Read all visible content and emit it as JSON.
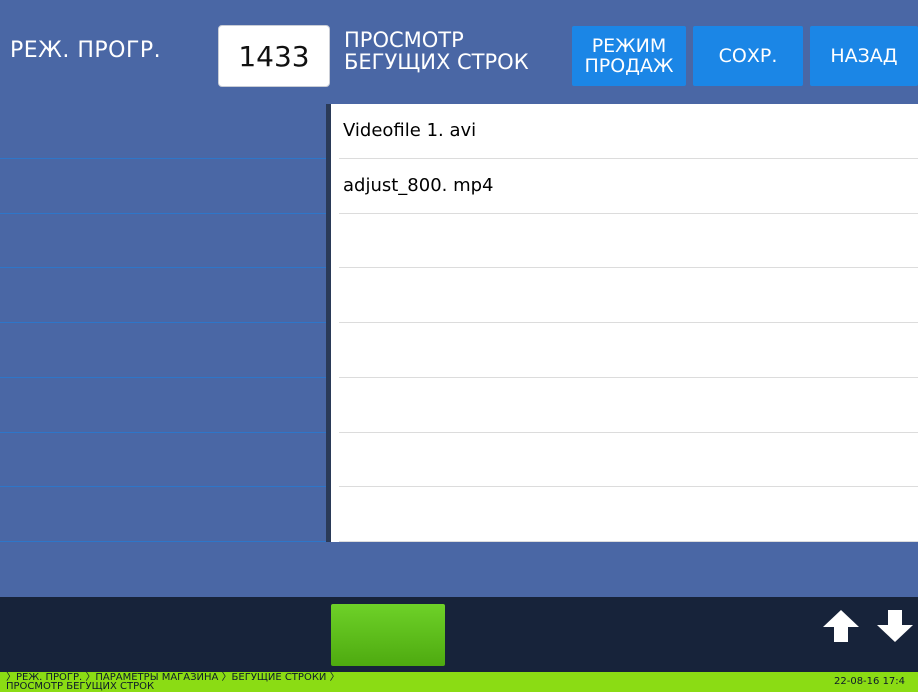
{
  "header": {
    "mode_label": "РЕЖ. ПРОГР.",
    "program_number": "1433",
    "title_line1": "ПРОСМОТР",
    "title_line2": "БЕГУЩИХ СТРОК",
    "sales_mode_line1": "РЕЖИМ",
    "sales_mode_line2": "ПРОДАЖ",
    "save_label": "СОХР.",
    "back_label": "НАЗАД"
  },
  "list": {
    "items": [
      "Videofile 1. avi",
      "adjust_800. mp4",
      "",
      "",
      "",
      "",
      "",
      ""
    ]
  },
  "footer": {
    "up_icon": "arrow-up-icon",
    "down_icon": "arrow-down-icon"
  },
  "statusbar": {
    "breadcrumb_line1": "〉РЕЖ. ПРОГР. 〉ПАРАМЕТРЫ МАГАЗИНА 〉БЕГУЩИЕ СТРОКИ 〉",
    "breadcrumb_line2": "ПРОСМОТР БЕГУЩИХ СТРОК",
    "datetime": "22-08-16 17:4"
  },
  "colors": {
    "header_bg": "#4a67a5",
    "button_blue": "#1b86e6",
    "footer_bg": "#17233a",
    "green_accent": "#5cc019",
    "status_green": "#8bdc14"
  }
}
